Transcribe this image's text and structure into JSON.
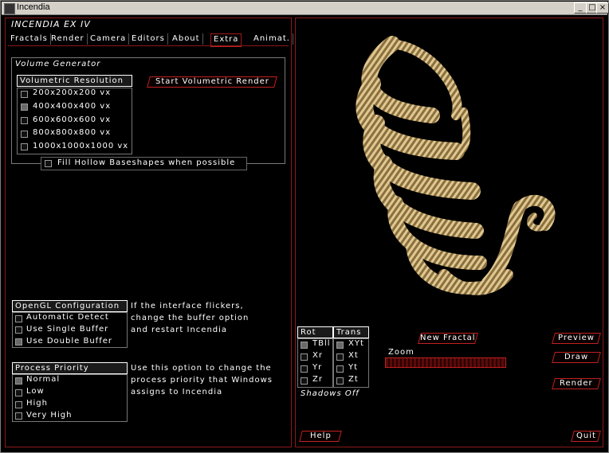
{
  "window": {
    "title": "Incendia"
  },
  "app": {
    "title": "INCENDIA EX IV"
  },
  "tabs": [
    "Fractals",
    "Render",
    "Camera",
    "Editors",
    "About",
    "Extra",
    "Animat."
  ],
  "active_tab": "Extra",
  "volume_generator": {
    "label": "Volume Generator",
    "resolution_header": "Volumetric Resolution",
    "resolutions": [
      {
        "label": "200x200x200 vx",
        "checked": false
      },
      {
        "label": "400x400x400 vx",
        "checked": true
      },
      {
        "label": "600x600x600 vx",
        "checked": false
      },
      {
        "label": "800x800x800 vx",
        "checked": false
      },
      {
        "label": "1000x1000x1000 vx",
        "checked": false
      }
    ],
    "start_button": "Start Volumetric Render",
    "fill_hollow": {
      "label": "Fill Hollow Baseshapes when possible",
      "checked": false
    }
  },
  "opengl": {
    "header": "OpenGL Configuration",
    "options": [
      {
        "label": "Automatic Detect",
        "checked": false
      },
      {
        "label": "Use Single Buffer",
        "checked": false
      },
      {
        "label": "Use Double Buffer",
        "checked": true
      }
    ],
    "note_lines": [
      "If the interface flickers,",
      "change the buffer option",
      "and restart Incendia"
    ]
  },
  "priority": {
    "header": "Process Priority",
    "options": [
      {
        "label": "Normal",
        "checked": true
      },
      {
        "label": "Low",
        "checked": false
      },
      {
        "label": "High",
        "checked": false
      },
      {
        "label": "Very High",
        "checked": false
      }
    ],
    "note_lines": [
      "Use this option to change the",
      "process priority that Windows",
      "assigns to Incendia"
    ]
  },
  "rot": {
    "header": "Rot",
    "items": [
      {
        "label": "TBll",
        "checked": true
      },
      {
        "label": "Xr",
        "checked": false
      },
      {
        "label": "Yr",
        "checked": false
      },
      {
        "label": "Zr",
        "checked": false
      }
    ]
  },
  "trans": {
    "header": "Trans",
    "items": [
      {
        "label": "XYt",
        "checked": true
      },
      {
        "label": "Xt",
        "checked": false
      },
      {
        "label": "Yt",
        "checked": false
      },
      {
        "label": "Zt",
        "checked": false
      }
    ]
  },
  "shadows": "Shadows Off",
  "controls": {
    "new_fractal": "New Fractal",
    "zoom": "Zoom",
    "preview": "Preview",
    "draw": "Draw",
    "render": "Render",
    "help": "Help",
    "quit": "Quit"
  },
  "colors": {
    "accent": "#c02020",
    "frame": "#8a1a1a",
    "fractal": "#c8aa6e"
  }
}
